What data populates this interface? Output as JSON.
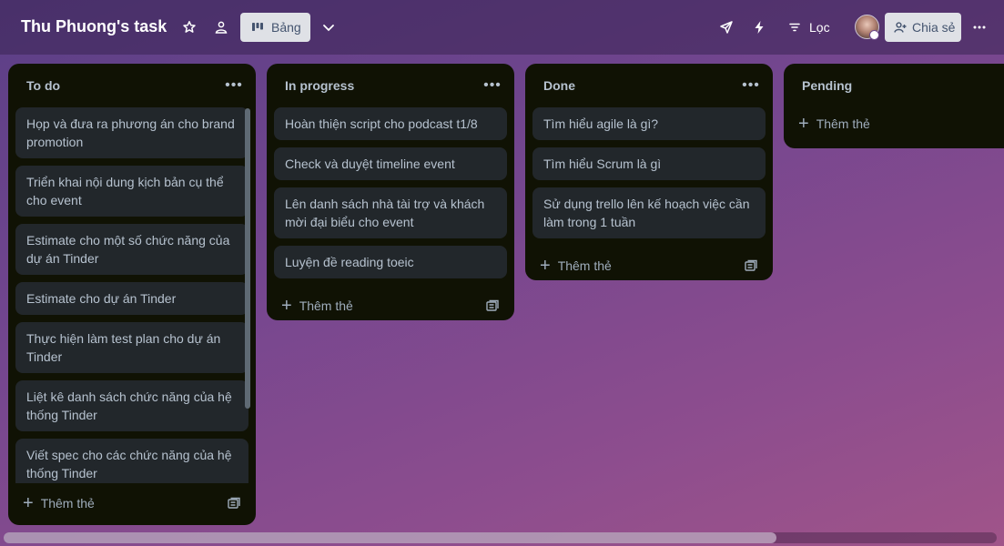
{
  "header": {
    "board_title": "Thu Phuong's task",
    "view_label": "Bảng",
    "filter_label": "Lọc",
    "share_label": "Chia sẻ"
  },
  "lists": [
    {
      "title": "To do",
      "cards": [
        "Họp và đưa ra phương án cho brand promotion",
        "Triển khai nội dung kịch bản cụ thể cho event",
        "Estimate cho một số chức năng của dự án Tinder",
        "Estimate cho dự án Tinder",
        "Thực hiện làm test plan cho dự án Tinder",
        "Liệt kê danh sách chức năng của hệ thống Tinder",
        "Viết spec cho các chức năng của hệ thống Tinder"
      ],
      "add_label": "Thêm thẻ"
    },
    {
      "title": "In progress",
      "cards": [
        "Hoàn thiện script cho podcast t1/8",
        "Check và duyệt timeline event",
        "Lên danh sách nhà tài trợ và khách mời đại biểu cho event",
        "Luyện đề reading toeic"
      ],
      "add_label": "Thêm thẻ"
    },
    {
      "title": "Done",
      "cards": [
        "Tìm hiểu agile là gì?",
        "Tìm hiểu Scrum là gì",
        "Sử dụng trello lên kế hoạch việc cần làm trong 1 tuần"
      ],
      "add_label": "Thêm thẻ"
    },
    {
      "title": "Pending",
      "cards": [],
      "add_label": "Thêm thẻ"
    }
  ],
  "icons": {
    "star": "star-icon",
    "workspace": "people-icon",
    "board": "board-icon",
    "chevron": "chevron-down-icon",
    "power_ups": "rocket-icon",
    "automation": "lightning-icon",
    "filter": "filter-icon",
    "share": "add-person-icon",
    "more": "more-icon",
    "template": "card-template-icon"
  },
  "colors": {
    "list_bg": "#101204",
    "card_bg": "#22272b",
    "text": "#b6c2cf",
    "header_button_bg": "#dfe1e6"
  }
}
